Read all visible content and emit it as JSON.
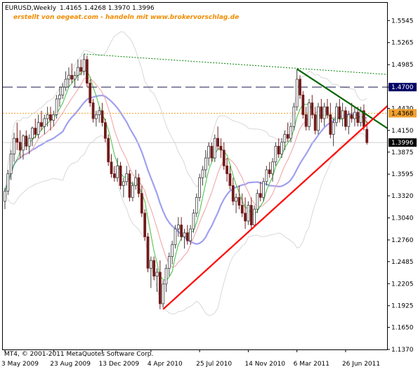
{
  "chart_data": {
    "type": "candlestick",
    "symbol_timeframe": "EURUSD,Weekly",
    "ohlc_readout": "1.4165 1.4268 1.3970 1.3996",
    "subtitle": "erstellt von oegeat.com - handeln mit www.brokervorschlag.de",
    "footer": "MT4, © 2001-2011 MetaQuotes Software Corp.",
    "ylim": [
      1.137,
      1.577
    ],
    "y_ticks": [
      "1.5545",
      "1.5265",
      "1.4985",
      "1.4700",
      "1.4430",
      "1.4150",
      "1.3875",
      "1.3595",
      "1.3320",
      "1.3040",
      "1.2760",
      "1.2485",
      "1.2205",
      "1.1925",
      "1.1650",
      "1.1370"
    ],
    "x_ticks": [
      "3 May 2009",
      "23 Aug 2009",
      "13 Dec 2009",
      "4 Apr 2010",
      "25 Jul 2010",
      "14 Nov 2010",
      "6 Mar 2011",
      "26 Jun 2011"
    ],
    "x_tick_week_index": [
      0,
      16,
      32,
      48,
      64,
      80,
      96,
      112
    ],
    "n_weeks": 121,
    "levels": [
      {
        "value": 1.47,
        "label": "1.4700",
        "style": "dashed",
        "color": "#1a1a4d",
        "label_bg": "#000066",
        "label_fg": "#ffffff"
      },
      {
        "value": 1.4368,
        "label": "1.4368",
        "style": "dotted",
        "color": "#f0a030",
        "label_bg": "#f0a030",
        "label_fg": "#000000"
      },
      {
        "value": 1.3996,
        "label": "1.3996",
        "style": "solid",
        "color": "#d0d0d0",
        "label_bg": "#000000",
        "label_fg": "#ffffff"
      }
    ],
    "trendlines": [
      {
        "name": "resistance-dotted",
        "color": "#008000",
        "style": "dotted",
        "width": 1,
        "p1": [
          26,
          1.512
        ],
        "p2": [
          126,
          1.486
        ]
      },
      {
        "name": "resistance-solid",
        "color": "#006400",
        "style": "solid",
        "width": 2.2,
        "p1": [
          96,
          1.493
        ],
        "p2": [
          126,
          1.417
        ]
      },
      {
        "name": "support",
        "color": "#ff0000",
        "style": "solid",
        "width": 2.2,
        "p1": [
          52,
          1.188
        ],
        "p2": [
          126,
          1.447
        ]
      }
    ],
    "candles": [
      [
        1.325,
        1.342,
        1.315,
        1.338
      ],
      [
        1.338,
        1.365,
        1.333,
        1.36
      ],
      [
        1.36,
        1.39,
        1.352,
        1.385
      ],
      [
        1.385,
        1.412,
        1.375,
        1.405
      ],
      [
        1.405,
        1.425,
        1.39,
        1.4
      ],
      [
        1.4,
        1.415,
        1.38,
        1.39
      ],
      [
        1.39,
        1.41,
        1.378,
        1.408
      ],
      [
        1.408,
        1.415,
        1.39,
        1.395
      ],
      [
        1.395,
        1.41,
        1.385,
        1.405
      ],
      [
        1.405,
        1.42,
        1.395,
        1.418
      ],
      [
        1.418,
        1.43,
        1.405,
        1.41
      ],
      [
        1.41,
        1.435,
        1.405,
        1.425
      ],
      [
        1.425,
        1.44,
        1.415,
        1.42
      ],
      [
        1.42,
        1.435,
        1.41,
        1.43
      ],
      [
        1.43,
        1.445,
        1.42,
        1.435
      ],
      [
        1.435,
        1.445,
        1.415,
        1.428
      ],
      [
        1.428,
        1.44,
        1.42,
        1.435
      ],
      [
        1.435,
        1.46,
        1.43,
        1.455
      ],
      [
        1.455,
        1.47,
        1.445,
        1.46
      ],
      [
        1.46,
        1.475,
        1.455,
        1.47
      ],
      [
        1.47,
        1.49,
        1.465,
        1.48
      ],
      [
        1.48,
        1.495,
        1.47,
        1.485
      ],
      [
        1.485,
        1.5,
        1.475,
        1.48
      ],
      [
        1.48,
        1.49,
        1.47,
        1.485
      ],
      [
        1.485,
        1.505,
        1.478,
        1.495
      ],
      [
        1.495,
        1.505,
        1.485,
        1.49
      ],
      [
        1.49,
        1.512,
        1.485,
        1.505
      ],
      [
        1.505,
        1.51,
        1.47,
        1.475
      ],
      [
        1.475,
        1.48,
        1.445,
        1.45
      ],
      [
        1.45,
        1.455,
        1.425,
        1.43
      ],
      [
        1.43,
        1.44,
        1.42,
        1.435
      ],
      [
        1.435,
        1.445,
        1.425,
        1.44
      ],
      [
        1.44,
        1.45,
        1.42,
        1.425
      ],
      [
        1.425,
        1.43,
        1.4,
        1.405
      ],
      [
        1.405,
        1.41,
        1.37,
        1.375
      ],
      [
        1.375,
        1.385,
        1.355,
        1.36
      ],
      [
        1.36,
        1.37,
        1.35,
        1.355
      ],
      [
        1.355,
        1.38,
        1.35,
        1.37
      ],
      [
        1.37,
        1.375,
        1.34,
        1.345
      ],
      [
        1.345,
        1.355,
        1.33,
        1.35
      ],
      [
        1.35,
        1.37,
        1.345,
        1.36
      ],
      [
        1.36,
        1.365,
        1.325,
        1.33
      ],
      [
        1.33,
        1.35,
        1.325,
        1.345
      ],
      [
        1.345,
        1.365,
        1.34,
        1.355
      ],
      [
        1.355,
        1.36,
        1.33,
        1.335
      ],
      [
        1.335,
        1.345,
        1.305,
        1.31
      ],
      [
        1.31,
        1.315,
        1.275,
        1.28
      ],
      [
        1.28,
        1.285,
        1.235,
        1.24
      ],
      [
        1.24,
        1.255,
        1.215,
        1.25
      ],
      [
        1.25,
        1.255,
        1.225,
        1.23
      ],
      [
        1.23,
        1.24,
        1.21,
        1.235
      ],
      [
        1.235,
        1.25,
        1.188,
        1.195
      ],
      [
        1.195,
        1.225,
        1.19,
        1.22
      ],
      [
        1.22,
        1.245,
        1.21,
        1.24
      ],
      [
        1.24,
        1.26,
        1.23,
        1.255
      ],
      [
        1.255,
        1.275,
        1.245,
        1.27
      ],
      [
        1.27,
        1.295,
        1.265,
        1.29
      ],
      [
        1.29,
        1.305,
        1.28,
        1.295
      ],
      [
        1.295,
        1.305,
        1.275,
        1.28
      ],
      [
        1.28,
        1.29,
        1.265,
        1.285
      ],
      [
        1.285,
        1.295,
        1.27,
        1.275
      ],
      [
        1.275,
        1.295,
        1.27,
        1.29
      ],
      [
        1.29,
        1.315,
        1.285,
        1.31
      ],
      [
        1.31,
        1.335,
        1.305,
        1.33
      ],
      [
        1.33,
        1.36,
        1.325,
        1.355
      ],
      [
        1.355,
        1.37,
        1.345,
        1.365
      ],
      [
        1.365,
        1.39,
        1.355,
        1.38
      ],
      [
        1.38,
        1.4,
        1.37,
        1.395
      ],
      [
        1.395,
        1.4,
        1.375,
        1.38
      ],
      [
        1.38,
        1.41,
        1.375,
        1.405
      ],
      [
        1.405,
        1.42,
        1.39,
        1.395
      ],
      [
        1.395,
        1.405,
        1.38,
        1.39
      ],
      [
        1.39,
        1.4,
        1.365,
        1.37
      ],
      [
        1.37,
        1.38,
        1.35,
        1.36
      ],
      [
        1.36,
        1.37,
        1.34,
        1.345
      ],
      [
        1.345,
        1.355,
        1.32,
        1.325
      ],
      [
        1.325,
        1.335,
        1.31,
        1.33
      ],
      [
        1.33,
        1.345,
        1.315,
        1.32
      ],
      [
        1.32,
        1.335,
        1.305,
        1.31
      ],
      [
        1.31,
        1.33,
        1.29,
        1.3
      ],
      [
        1.3,
        1.325,
        1.295,
        1.32
      ],
      [
        1.32,
        1.33,
        1.29,
        1.295
      ],
      [
        1.295,
        1.32,
        1.292,
        1.315
      ],
      [
        1.315,
        1.34,
        1.31,
        1.335
      ],
      [
        1.335,
        1.35,
        1.325,
        1.33
      ],
      [
        1.33,
        1.355,
        1.325,
        1.35
      ],
      [
        1.35,
        1.37,
        1.345,
        1.365
      ],
      [
        1.365,
        1.375,
        1.355,
        1.36
      ],
      [
        1.36,
        1.38,
        1.35,
        1.375
      ],
      [
        1.375,
        1.4,
        1.37,
        1.395
      ],
      [
        1.395,
        1.405,
        1.38,
        1.385
      ],
      [
        1.385,
        1.405,
        1.38,
        1.4
      ],
      [
        1.4,
        1.415,
        1.39,
        1.41
      ],
      [
        1.41,
        1.425,
        1.4,
        1.405
      ],
      [
        1.405,
        1.425,
        1.4,
        1.42
      ],
      [
        1.42,
        1.45,
        1.415,
        1.445
      ],
      [
        1.445,
        1.493,
        1.44,
        1.48
      ],
      [
        1.48,
        1.485,
        1.455,
        1.46
      ],
      [
        1.46,
        1.465,
        1.43,
        1.435
      ],
      [
        1.435,
        1.445,
        1.415,
        1.42
      ],
      [
        1.42,
        1.455,
        1.415,
        1.45
      ],
      [
        1.45,
        1.46,
        1.43,
        1.435
      ],
      [
        1.435,
        1.445,
        1.41,
        1.415
      ],
      [
        1.415,
        1.45,
        1.41,
        1.445
      ],
      [
        1.445,
        1.455,
        1.425,
        1.43
      ],
      [
        1.43,
        1.45,
        1.42,
        1.445
      ],
      [
        1.445,
        1.455,
        1.43,
        1.435
      ],
      [
        1.435,
        1.45,
        1.405,
        1.41
      ],
      [
        1.41,
        1.43,
        1.395,
        1.425
      ],
      [
        1.425,
        1.45,
        1.42,
        1.445
      ],
      [
        1.445,
        1.455,
        1.425,
        1.43
      ],
      [
        1.43,
        1.45,
        1.42,
        1.44
      ],
      [
        1.44,
        1.445,
        1.415,
        1.42
      ],
      [
        1.42,
        1.44,
        1.41,
        1.435
      ],
      [
        1.435,
        1.45,
        1.425,
        1.43
      ],
      [
        1.43,
        1.445,
        1.42,
        1.438
      ],
      [
        1.438,
        1.445,
        1.42,
        1.425
      ],
      [
        1.425,
        1.445,
        1.42,
        1.44
      ],
      [
        1.44,
        1.448,
        1.415,
        1.42
      ],
      [
        1.4165,
        1.4268,
        1.397,
        1.3996
      ]
    ]
  }
}
